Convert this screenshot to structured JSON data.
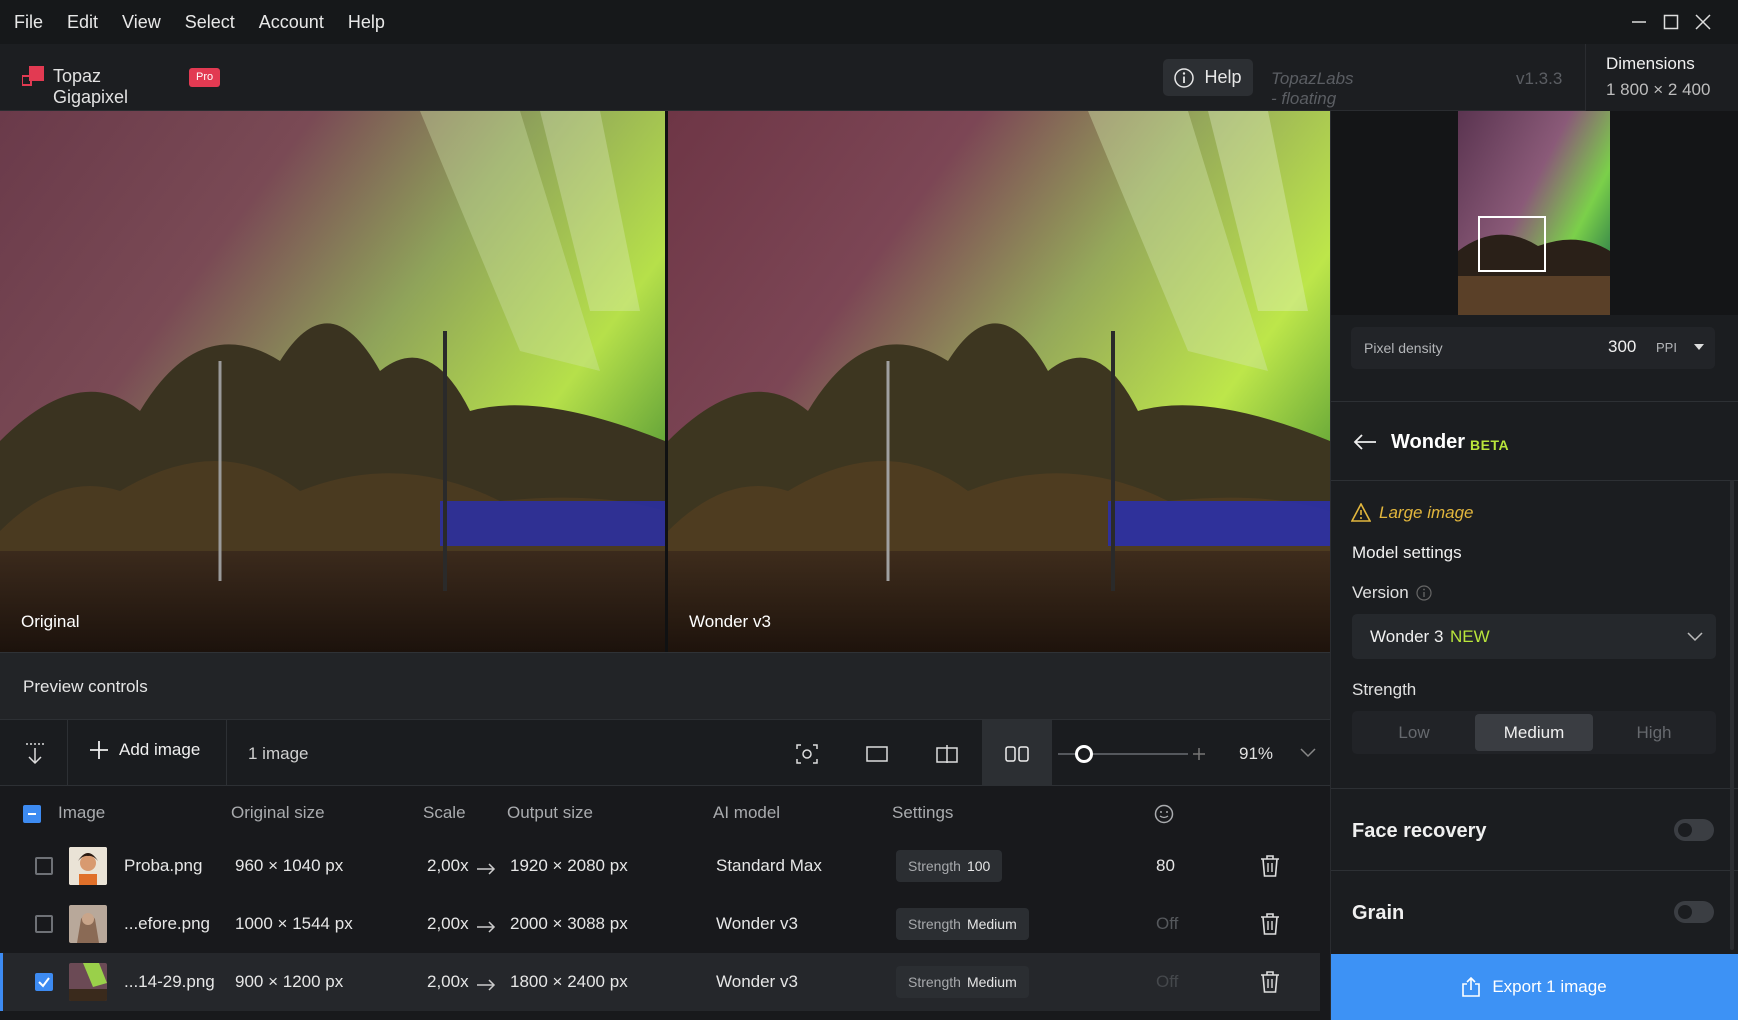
{
  "menu": [
    "File",
    "Edit",
    "View",
    "Select",
    "Account",
    "Help"
  ],
  "app": {
    "name": "Topaz Gigapixel",
    "badge": "Pro",
    "help_label": "Help",
    "license": "TopazLabs - floating license",
    "version": "v1.3.3"
  },
  "dimensions": {
    "title": "Dimensions",
    "value": "1 800 × 2 400"
  },
  "preview": {
    "left_label": "Original",
    "right_label": "Wonder v3",
    "controls_label": "Preview controls"
  },
  "toolbar": {
    "add_image_label": "Add image",
    "image_count": "1 image",
    "zoom": "91%",
    "zoom_fraction": 0.2
  },
  "table": {
    "headers": {
      "image": "Image",
      "original_size": "Original size",
      "scale": "Scale",
      "output_size": "Output size",
      "ai_model": "AI model",
      "settings": "Settings"
    },
    "rows": [
      {
        "name": "Proba.png",
        "original": "960 × 1040 px",
        "scale": "2,00x",
        "output": "1920 × 2080 px",
        "model": "Standard Max",
        "setting_key": "Strength",
        "setting_value": "100",
        "face": "80",
        "checked": false
      },
      {
        "name": "...efore.png",
        "original": "1000 × 1544 px",
        "scale": "2,00x",
        "output": "2000 × 3088 px",
        "model": "Wonder v3",
        "setting_key": "Strength",
        "setting_value": "Medium",
        "face": "Off",
        "checked": false
      },
      {
        "name": "...14-29.png",
        "original": "900 × 1200 px",
        "scale": "2,00x",
        "output": "1800 × 2400 px",
        "model": "Wonder v3",
        "setting_key": "Strength",
        "setting_value": "Medium",
        "face": "Off",
        "checked": true
      }
    ]
  },
  "panel": {
    "pixel_density": {
      "label": "Pixel density",
      "value": "300",
      "unit": "PPI"
    },
    "model": {
      "title": "Wonder",
      "badge": "BETA"
    },
    "warning": "Large image",
    "model_settings": "Model settings",
    "version_label": "Version",
    "version_value": "Wonder 3",
    "version_new": "NEW",
    "strength_label": "Strength",
    "strength_options": [
      "Low",
      "Medium",
      "High"
    ],
    "strength_selected": "Medium",
    "face_recovery": {
      "label": "Face recovery",
      "on": false
    },
    "grain": {
      "label": "Grain",
      "on": false
    },
    "export_label": "Export 1 image"
  },
  "colors": {
    "accent": "#3d92f5",
    "beta": "#b9e53b",
    "warning": "#e2b63d",
    "pro_badge": "#e23a52"
  }
}
